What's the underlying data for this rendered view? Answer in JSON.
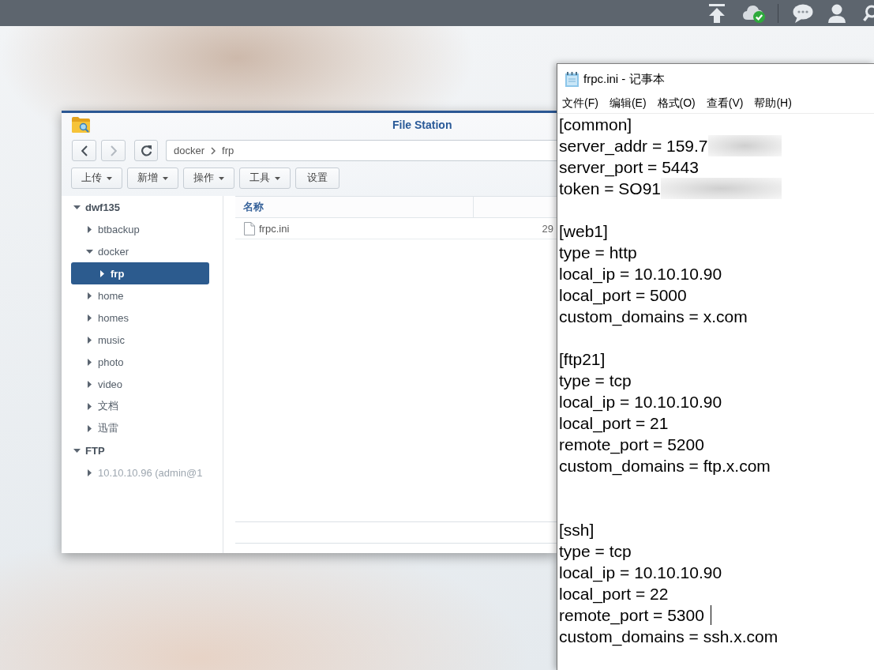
{
  "file_station": {
    "title": "File Station",
    "nav_buttons": [
      {
        "kind": "back",
        "disabled": false
      },
      {
        "kind": "forward",
        "disabled": true
      },
      {
        "kind": "refresh",
        "disabled": false
      }
    ],
    "path": [
      "docker",
      "frp"
    ],
    "toolbar": [
      {
        "label": "上传",
        "dropdown": true
      },
      {
        "label": "新增",
        "dropdown": true
      },
      {
        "label": "操作",
        "dropdown": true
      },
      {
        "label": "工具",
        "dropdown": true
      },
      {
        "label": "设置",
        "dropdown": false
      }
    ],
    "tree": [
      {
        "label": "dwf135",
        "expanded": true,
        "selected": false,
        "disabled": false,
        "children": [
          {
            "label": "btbackup",
            "expanded": false,
            "selected": false,
            "disabled": false
          },
          {
            "label": "docker",
            "expanded": true,
            "selected": false,
            "disabled": false,
            "children": [
              {
                "label": "frp",
                "expanded": false,
                "selected": true,
                "disabled": false
              }
            ]
          },
          {
            "label": "home",
            "expanded": false,
            "selected": false,
            "disabled": false
          },
          {
            "label": "homes",
            "expanded": false,
            "selected": false,
            "disabled": false
          },
          {
            "label": "music",
            "expanded": false,
            "selected": false,
            "disabled": false
          },
          {
            "label": "photo",
            "expanded": false,
            "selected": false,
            "disabled": false
          },
          {
            "label": "video",
            "expanded": false,
            "selected": false,
            "disabled": false
          },
          {
            "label": "文档",
            "expanded": false,
            "selected": false,
            "disabled": false
          },
          {
            "label": "迅雷",
            "expanded": false,
            "selected": false,
            "disabled": false
          }
        ]
      },
      {
        "label": "FTP",
        "expanded": true,
        "selected": false,
        "disabled": false,
        "children": [
          {
            "label": "10.10.10.96 (admin@1",
            "expanded": false,
            "selected": false,
            "disabled": true
          }
        ]
      }
    ],
    "list": {
      "columns": [
        "名称"
      ],
      "rows": [
        {
          "name": "frpc.ini",
          "column_2": "29"
        }
      ]
    }
  },
  "notepad": {
    "title": "frpc.ini - 记事本",
    "menu": [
      "文件(F)",
      "编辑(E)",
      "格式(O)",
      "查看(V)",
      "帮助(H)"
    ],
    "lines": [
      {
        "kind": "text",
        "text": "[common]"
      },
      {
        "kind": "redacted",
        "text": "server_addr = 159.7"
      },
      {
        "kind": "text",
        "text": "server_port = 5443"
      },
      {
        "kind": "redacted",
        "text": "token = SO91"
      },
      {
        "kind": "blank"
      },
      {
        "kind": "text",
        "text": "[web1]"
      },
      {
        "kind": "text",
        "text": "type = http"
      },
      {
        "kind": "text",
        "text": "local_ip = 10.10.10.90"
      },
      {
        "kind": "text",
        "text": "local_port = 5000"
      },
      {
        "kind": "text",
        "text": "custom_domains = x.com"
      },
      {
        "kind": "blank"
      },
      {
        "kind": "text",
        "text": "[ftp21]"
      },
      {
        "kind": "text",
        "text": "type = tcp"
      },
      {
        "kind": "text",
        "text": "local_ip = 10.10.10.90"
      },
      {
        "kind": "text",
        "text": "local_port = 21"
      },
      {
        "kind": "text",
        "text": "remote_port = 5200"
      },
      {
        "kind": "text",
        "text": "custom_domains = ftp.x.com"
      },
      {
        "kind": "blank"
      },
      {
        "kind": "blank"
      },
      {
        "kind": "text",
        "text": "[ssh]"
      },
      {
        "kind": "text",
        "text": "type = tcp"
      },
      {
        "kind": "text",
        "text": "local_ip = 10.10.10.90"
      },
      {
        "kind": "text",
        "text": "local_port = 22"
      },
      {
        "kind": "caret",
        "text": "remote_port = 5300"
      },
      {
        "kind": "text",
        "text": "custom_domains = ssh.x.com"
      }
    ]
  }
}
